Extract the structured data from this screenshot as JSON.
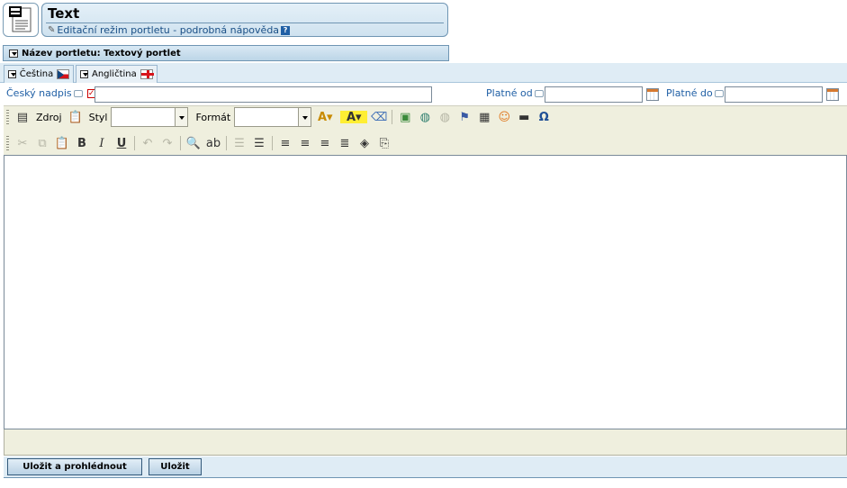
{
  "header": {
    "title": "Text",
    "subtitle": "Editační režim portletu - podrobná nápověda",
    "help_icon": "question-icon"
  },
  "portlet_name": {
    "label": "Název portletu: Textový portlet"
  },
  "tabs": [
    {
      "label": "Čeština",
      "flag": "cz-flag-icon",
      "active": true
    },
    {
      "label": "Angličtina",
      "flag": "uk-flag-icon",
      "active": false
    }
  ],
  "fields": {
    "heading_label": "Český nadpis",
    "heading_value": "",
    "valid_from_label": "Platné od",
    "valid_from_value": "",
    "valid_to_label": "Platné do",
    "valid_to_value": ""
  },
  "toolbar": {
    "source_label": "Zdroj",
    "style_label": "Styl",
    "style_value": "",
    "format_label": "Formát",
    "format_value": ""
  },
  "buttons": {
    "save_preview": "Uložit a prohlédnout",
    "save": "Uložit"
  },
  "colors": {
    "accent": "#1f5fa5",
    "header_bg": "#cfe2ef",
    "toolbar_bg": "#efefde"
  }
}
